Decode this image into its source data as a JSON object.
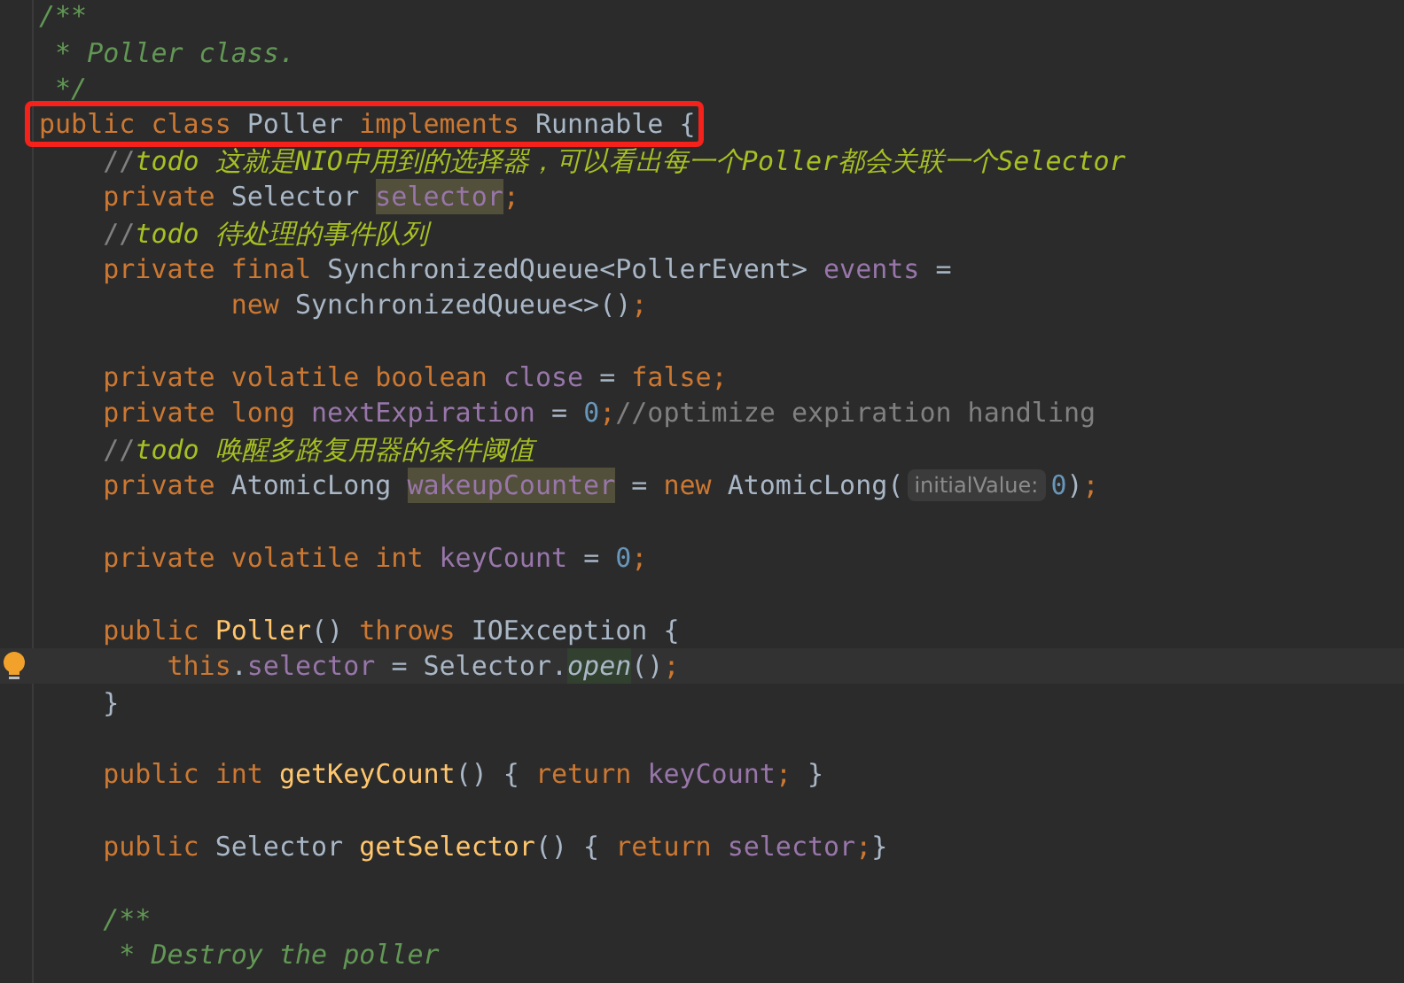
{
  "editor": {
    "lines": [
      {
        "tokens": [
          {
            "kind": "doc",
            "text": "/**"
          }
        ]
      },
      {
        "tokens": [
          {
            "kind": "doc",
            "text": " * Poller class."
          }
        ]
      },
      {
        "tokens": [
          {
            "kind": "doc",
            "text": " */"
          }
        ]
      },
      {
        "boxed": true,
        "tokens": [
          {
            "kind": "kw",
            "text": "public class "
          },
          {
            "kind": "plain",
            "text": "Poller "
          },
          {
            "kind": "kw",
            "text": "implements "
          },
          {
            "kind": "plain",
            "text": "Runnable {"
          }
        ]
      },
      {
        "tokens": [
          {
            "kind": "comment",
            "text": "    //"
          },
          {
            "kind": "todo",
            "text": "todo 这就是NIO中用到的选择器，可以看出每一个Poller都会关联一个Selector"
          }
        ]
      },
      {
        "tokens": [
          {
            "kind": "kw",
            "text": "    private "
          },
          {
            "kind": "plain",
            "text": "Selector "
          },
          {
            "kind": "field_highlighted",
            "text": "selector"
          },
          {
            "kind": "kw",
            "text": ";"
          }
        ]
      },
      {
        "tokens": [
          {
            "kind": "comment",
            "text": "    //"
          },
          {
            "kind": "todo",
            "text": "todo 待处理的事件队列"
          }
        ]
      },
      {
        "tokens": [
          {
            "kind": "kw",
            "text": "    private final "
          },
          {
            "kind": "plain",
            "text": "SynchronizedQueue<PollerEvent> "
          },
          {
            "kind": "field",
            "text": "events "
          },
          {
            "kind": "plain",
            "text": "="
          }
        ]
      },
      {
        "tokens": [
          {
            "kind": "kw",
            "text": "            new "
          },
          {
            "kind": "plain",
            "text": "SynchronizedQueue<>()"
          },
          {
            "kind": "kw",
            "text": ";"
          }
        ]
      },
      {
        "blank": true
      },
      {
        "tokens": [
          {
            "kind": "kw",
            "text": "    private volatile boolean "
          },
          {
            "kind": "field",
            "text": "close "
          },
          {
            "kind": "plain",
            "text": "= "
          },
          {
            "kind": "kw",
            "text": "false;"
          }
        ]
      },
      {
        "tokens": [
          {
            "kind": "kw",
            "text": "    private long "
          },
          {
            "kind": "field",
            "text": "nextExpiration "
          },
          {
            "kind": "plain",
            "text": "= "
          },
          {
            "kind": "num",
            "text": "0"
          },
          {
            "kind": "kw",
            "text": ";"
          },
          {
            "kind": "comment",
            "text": "//optimize expiration handling"
          }
        ]
      },
      {
        "tokens": [
          {
            "kind": "comment",
            "text": "    //"
          },
          {
            "kind": "todo",
            "text": "todo 唤醒多路复用器的条件阈值"
          }
        ]
      },
      {
        "tokens": [
          {
            "kind": "kw",
            "text": "    private "
          },
          {
            "kind": "plain",
            "text": "AtomicLong "
          },
          {
            "kind": "field_highlighted",
            "text": "wakeupCounter"
          },
          {
            "kind": "plain",
            "text": " = "
          },
          {
            "kind": "kw",
            "text": "new "
          },
          {
            "kind": "plain",
            "text": "AtomicLong("
          },
          {
            "kind": "hint",
            "text": "initialValue:"
          },
          {
            "kind": "num",
            "text": "0"
          },
          {
            "kind": "plain",
            "text": ")"
          },
          {
            "kind": "kw",
            "text": ";"
          }
        ]
      },
      {
        "blank": true
      },
      {
        "tokens": [
          {
            "kind": "kw",
            "text": "    private volatile int "
          },
          {
            "kind": "field",
            "text": "keyCount "
          },
          {
            "kind": "plain",
            "text": "= "
          },
          {
            "kind": "num",
            "text": "0"
          },
          {
            "kind": "kw",
            "text": ";"
          }
        ]
      },
      {
        "blank": true
      },
      {
        "tokens": [
          {
            "kind": "kw",
            "text": "    public "
          },
          {
            "kind": "method",
            "text": "Poller"
          },
          {
            "kind": "plain",
            "text": "() "
          },
          {
            "kind": "kw",
            "text": "throws "
          },
          {
            "kind": "plain",
            "text": "IOException {"
          }
        ]
      },
      {
        "current": true,
        "tokens": [
          {
            "kind": "kw",
            "text": "        this"
          },
          {
            "kind": "plain",
            "text": "."
          },
          {
            "kind": "field",
            "text": "selector "
          },
          {
            "kind": "plain",
            "text": "= Selector."
          },
          {
            "kind": "static",
            "text": "open"
          },
          {
            "kind": "plain",
            "text": "()"
          },
          {
            "kind": "kw",
            "text": ";"
          }
        ]
      },
      {
        "tokens": [
          {
            "kind": "plain",
            "text": "    }"
          }
        ]
      },
      {
        "blank": true
      },
      {
        "tokens": [
          {
            "kind": "kw",
            "text": "    public int "
          },
          {
            "kind": "method",
            "text": "getKeyCount"
          },
          {
            "kind": "plain",
            "text": "() { "
          },
          {
            "kind": "kw",
            "text": "return "
          },
          {
            "kind": "field",
            "text": "keyCount"
          },
          {
            "kind": "kw",
            "text": "; "
          },
          {
            "kind": "plain",
            "text": "}"
          }
        ]
      },
      {
        "blank": true
      },
      {
        "tokens": [
          {
            "kind": "kw",
            "text": "    public "
          },
          {
            "kind": "plain",
            "text": "Selector "
          },
          {
            "kind": "method",
            "text": "getSelector"
          },
          {
            "kind": "plain",
            "text": "() { "
          },
          {
            "kind": "kw",
            "text": "return "
          },
          {
            "kind": "field",
            "text": "selector"
          },
          {
            "kind": "kw",
            "text": ";"
          },
          {
            "kind": "plain",
            "text": "}"
          }
        ]
      },
      {
        "blank": true
      },
      {
        "tokens": [
          {
            "kind": "doc",
            "text": "    /**"
          }
        ]
      },
      {
        "tokens": [
          {
            "kind": "doc",
            "text": "     * Destroy the poller"
          }
        ]
      }
    ]
  }
}
